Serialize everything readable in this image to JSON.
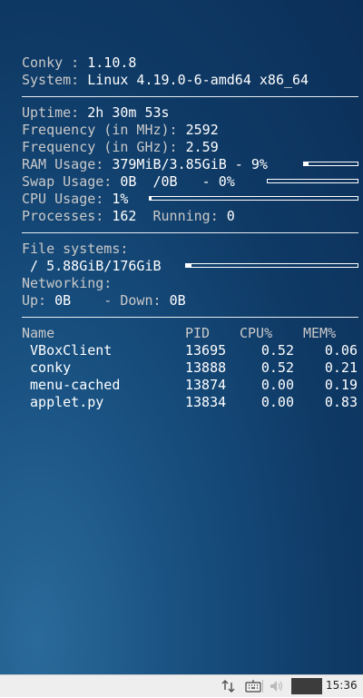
{
  "conky": {
    "version_label": "Conky : ",
    "version": "1.10.8",
    "system_label": "System: ",
    "system": "Linux 4.19.0-6-amd64 x86_64",
    "uptime_label": "Uptime: ",
    "uptime": "2h 30m 53s",
    "freq_mhz_label": "Frequency (in MHz): ",
    "freq_mhz": "2592",
    "freq_ghz_label": "Frequency (in GHz): ",
    "freq_ghz": "2.59",
    "ram_label": "RAM Usage: ",
    "ram": "379MiB/3.85GiB - 9%",
    "ram_fraction": 0.09,
    "swap_label": "Swap Usage: ",
    "swap": "0B  /0B   - 0%",
    "swap_fraction": 0.0,
    "cpu_label": "CPU Usage: ",
    "cpu": "1%",
    "cpu_fraction": 0.01,
    "processes_label": "Processes: ",
    "processes": "162",
    "running_label": "  Running: ",
    "running": "0",
    "fs_label": "File systems:",
    "fs_root": " / 5.88GiB/176GiB",
    "fs_fraction": 0.03,
    "net_label": "Networking:",
    "up_label": "Up: ",
    "up": "0B",
    "down_label": "    - Down: ",
    "down": "0B"
  },
  "processes": {
    "headers": {
      "name": "Name",
      "pid": "PID",
      "cpu": "CPU%",
      "mem": "MEM%"
    },
    "rows": [
      {
        "name": " VBoxClient",
        "pid": "13695",
        "cpu": "0.52",
        "mem": "0.06"
      },
      {
        "name": " conky",
        "pid": "13888",
        "cpu": "0.52",
        "mem": "0.21"
      },
      {
        "name": " menu-cached",
        "pid": "13874",
        "cpu": "0.00",
        "mem": "0.19"
      },
      {
        "name": " applet.py",
        "pid": "13834",
        "cpu": "0.00",
        "mem": "0.83"
      }
    ]
  },
  "taskbar": {
    "network_icon": "network-transfer-icon",
    "keyboard_icon": "keyboard-icon",
    "volume_icon": "volume-muted-icon",
    "clock": "15:36"
  }
}
